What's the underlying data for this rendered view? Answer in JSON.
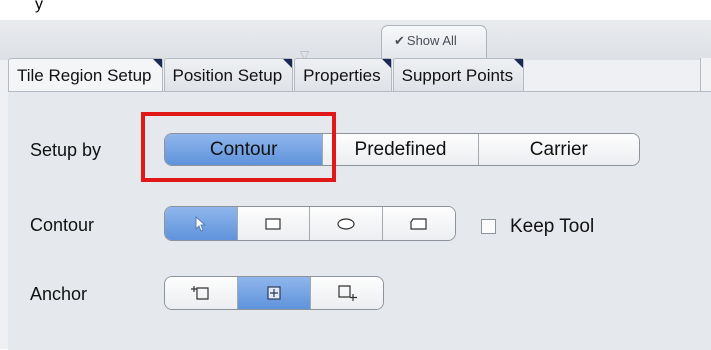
{
  "window": {
    "title": "y"
  },
  "toolbar": {
    "show_all_label": "Show All",
    "show_all_check": "✔"
  },
  "tabs": [
    {
      "label": "Tile Region Setup",
      "active": true
    },
    {
      "label": "Position Setup",
      "active": false
    },
    {
      "label": "Properties",
      "active": false
    },
    {
      "label": "Support Points",
      "active": false
    }
  ],
  "setup_by": {
    "label": "Setup by",
    "options": [
      "Contour",
      "Predefined",
      "Carrier"
    ],
    "selected": "Contour"
  },
  "contour": {
    "label": "Contour",
    "tools": [
      {
        "icon": "pointer-icon",
        "selected": true
      },
      {
        "icon": "rectangle-icon",
        "selected": false
      },
      {
        "icon": "ellipse-icon",
        "selected": false
      },
      {
        "icon": "polygon-icon",
        "selected": false
      }
    ],
    "keep_tool_label": "Keep Tool",
    "keep_tool_checked": false
  },
  "anchor": {
    "label": "Anchor",
    "options": [
      {
        "icon": "anchor-top-left-icon",
        "selected": false
      },
      {
        "icon": "anchor-center-icon",
        "selected": true
      },
      {
        "icon": "anchor-bottom-right-icon",
        "selected": false
      }
    ]
  },
  "colors": {
    "selected_accent": "#6a9de2",
    "highlight_box": "#e01818",
    "tab_corner": "#1a2a55"
  }
}
